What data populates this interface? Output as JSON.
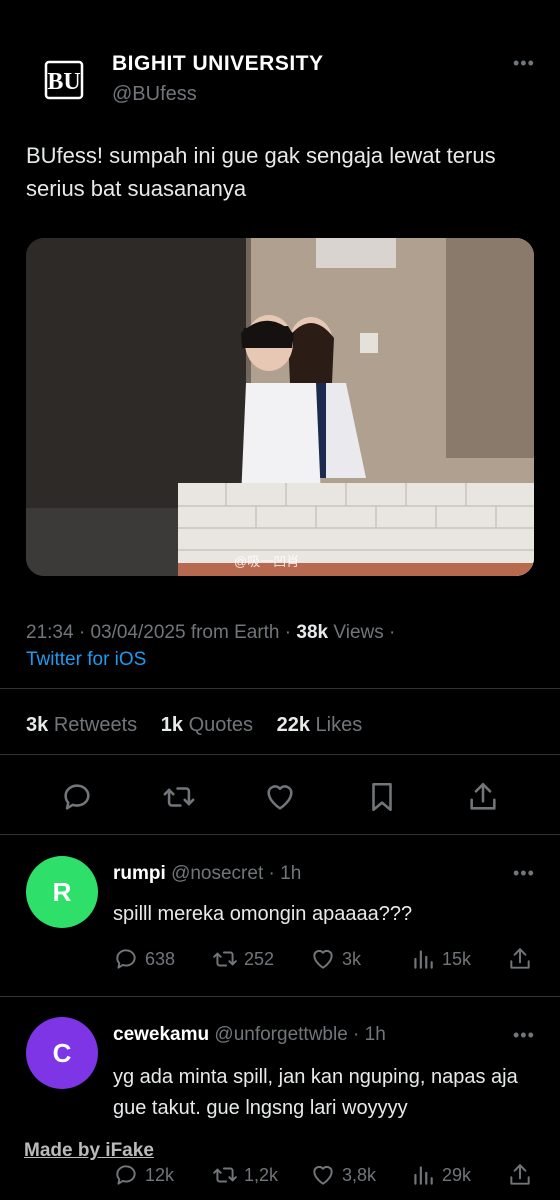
{
  "account": {
    "name": "BIGHIT UNIVERSITY",
    "handle": "@BUfess",
    "logo_text": "BU"
  },
  "tweet": {
    "text": "BUfess! sumpah ini gue gak sengaja lewat terus serius bat suasananya",
    "photo_watermark": "@吸一凹肖",
    "time": "21:34",
    "date": "03/04/2025",
    "location": "from Earth",
    "views_count": "38k",
    "views_label": "Views",
    "source": "Twitter for iOS",
    "retweets_count": "3k",
    "retweets_label": "Retweets",
    "quotes_count": "1k",
    "quotes_label": "Quotes",
    "likes_count": "22k",
    "likes_label": "Likes"
  },
  "replies": [
    {
      "avatar_letter": "R",
      "avatar_color": "#2ee06a",
      "name": "rumpi",
      "handle": "@nosecret",
      "time": "1h",
      "text": "spilll mereka omongin apaaaa???",
      "replies": "638",
      "retweets": "252",
      "likes": "3k",
      "views": "15k"
    },
    {
      "avatar_letter": "C",
      "avatar_color": "#7e35e6",
      "name": "cewekamu",
      "handle": "@unforgettwble",
      "time": "1h",
      "text": "yg ada minta spill, jan kan nguping, napas aja gue takut. gue lngsng lari woyyyy",
      "replies": "12k",
      "retweets": "1,2k",
      "likes": "3,8k",
      "views": "29k"
    }
  ],
  "watermark": "Made by iFake",
  "icons": [
    "more-icon",
    "reply-icon",
    "retweet-icon",
    "like-icon",
    "bookmark-icon",
    "share-icon",
    "views-icon"
  ],
  "colors": {
    "link": "#1d9bf0",
    "muted": "#71767b",
    "background": "#000000"
  }
}
